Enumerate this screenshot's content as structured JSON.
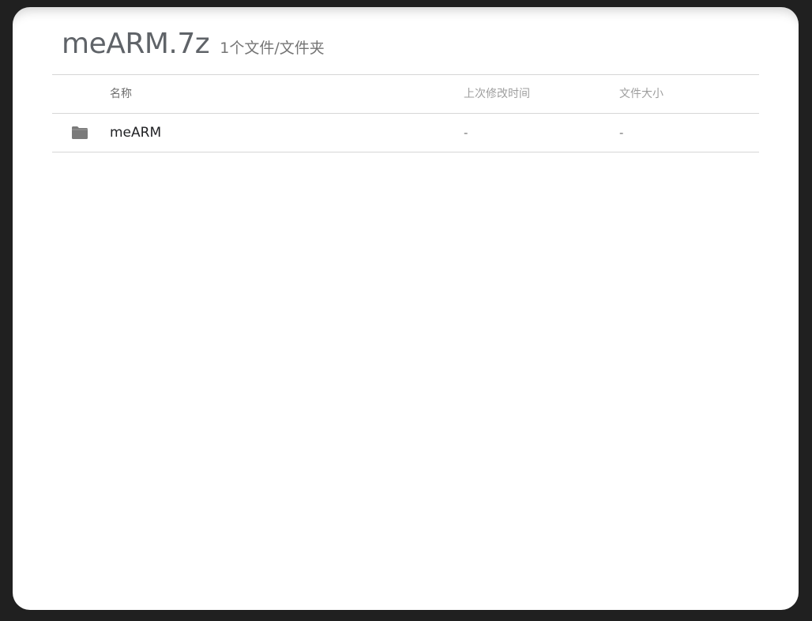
{
  "archive": {
    "title": "meARM.7z",
    "summary": "1个文件/文件夹"
  },
  "table": {
    "columns": {
      "name": "名称",
      "modified": "上次修改时间",
      "size": "文件大小"
    },
    "rows": [
      {
        "icon": "folder-icon",
        "name": "meARM",
        "modified": "-",
        "size": "-"
      }
    ]
  },
  "colors": {
    "background": "#202020",
    "panel": "#ffffff",
    "folder": "#7a7a7a",
    "divider": "#d6d6d6"
  }
}
